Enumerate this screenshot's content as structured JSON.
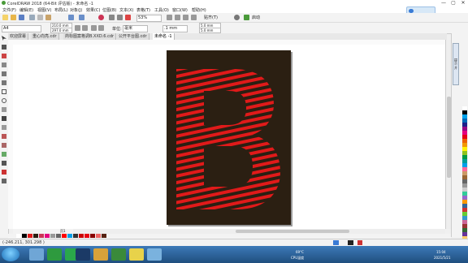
{
  "window": {
    "title": "CorelDRAW 2018 (64-Bit 评估版) - 未命名 -1",
    "controls": [
      "—",
      "▢",
      "✕"
    ]
  },
  "menubar": {
    "items": [
      "文件(F)",
      "编辑(E)",
      "视图(V)",
      "布局(L)",
      "对象(J)",
      "效果(C)",
      "位图(B)",
      "文本(X)",
      "表格(T)",
      "工具(O)",
      "窗口(W)",
      "帮助(H)"
    ]
  },
  "toolbar1": {
    "zoom": "53%",
    "snap_label": "贴齐(T)",
    "launch_label": "启动"
  },
  "toolbar2": {
    "page_size": "A4",
    "width": "210.0 mm",
    "height": "297.0 mm",
    "units_label": "单位:",
    "units_value": "毫米",
    "nudge": ".1 mm",
    "dup_x": "5.0 mm",
    "dup_y": "5.0 mm"
  },
  "tabs": [
    {
      "label": "欢迎屏幕",
      "active": false
    },
    {
      "label": "重心向亮.cdr",
      "active": false
    },
    {
      "label": "商标图案格调B.XXD.6.cdr",
      "active": false
    },
    {
      "label": "公开平台图.cdr",
      "active": false
    },
    {
      "label": "未命名 -1",
      "active": true
    }
  ],
  "docker": {
    "tab_label": "提示 开"
  },
  "artwork": {
    "letter": "B",
    "background_color": "#2b1f12",
    "stripe_color": "#e01a1a"
  },
  "pagenav": {
    "page_label": "页1"
  },
  "status": {
    "coords": "(-246.211, 301.298 )"
  },
  "taskbar": {
    "weather": "69°C",
    "cpu": "CPU温度",
    "time": "15:04",
    "date": "2021/5/21"
  },
  "colors": {
    "accent": "#3a7bd5",
    "taskbar": "#2b5f96"
  }
}
